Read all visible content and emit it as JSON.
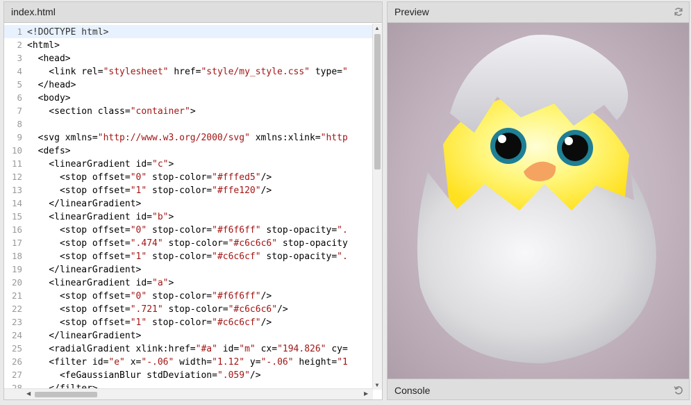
{
  "editor": {
    "filename": "index.html",
    "lines": [
      {
        "n": "1",
        "parts": [
          [
            "doc",
            "<!DOCTYPE html>"
          ]
        ]
      },
      {
        "n": "2",
        "parts": [
          [
            "tag",
            "<html>"
          ]
        ]
      },
      {
        "n": "3",
        "parts": [
          [
            "tag",
            "  <head>"
          ]
        ]
      },
      {
        "n": "4",
        "parts": [
          [
            "tag",
            "    <link rel="
          ],
          [
            "str",
            "\"stylesheet\""
          ],
          [
            "tag",
            " href="
          ],
          [
            "str",
            "\"style/my_style.css\""
          ],
          [
            "tag",
            " type="
          ],
          [
            "str",
            "\""
          ]
        ]
      },
      {
        "n": "5",
        "parts": [
          [
            "tag",
            "  </head>"
          ]
        ]
      },
      {
        "n": "6",
        "parts": [
          [
            "tag",
            "  <body>"
          ]
        ]
      },
      {
        "n": "7",
        "parts": [
          [
            "tag",
            "    <section class="
          ],
          [
            "str",
            "\"container\""
          ],
          [
            "tag",
            ">"
          ]
        ]
      },
      {
        "n": "8",
        "parts": []
      },
      {
        "n": "9",
        "parts": [
          [
            "tag",
            "  <svg xmlns="
          ],
          [
            "str",
            "\"http://www.w3.org/2000/svg\""
          ],
          [
            "tag",
            " xmlns:xlink="
          ],
          [
            "str",
            "\"http"
          ]
        ]
      },
      {
        "n": "10",
        "parts": [
          [
            "tag",
            "  <defs>"
          ]
        ]
      },
      {
        "n": "11",
        "parts": [
          [
            "tag",
            "    <linearGradient id="
          ],
          [
            "str",
            "\"c\""
          ],
          [
            "tag",
            ">"
          ]
        ]
      },
      {
        "n": "12",
        "parts": [
          [
            "tag",
            "      <stop offset="
          ],
          [
            "str",
            "\"0\""
          ],
          [
            "tag",
            " stop-color="
          ],
          [
            "str",
            "\"#fffed5\""
          ],
          [
            "tag",
            "/>"
          ]
        ]
      },
      {
        "n": "13",
        "parts": [
          [
            "tag",
            "      <stop offset="
          ],
          [
            "str",
            "\"1\""
          ],
          [
            "tag",
            " stop-color="
          ],
          [
            "str",
            "\"#ffe120\""
          ],
          [
            "tag",
            "/>"
          ]
        ]
      },
      {
        "n": "14",
        "parts": [
          [
            "tag",
            "    </linearGradient>"
          ]
        ]
      },
      {
        "n": "15",
        "parts": [
          [
            "tag",
            "    <linearGradient id="
          ],
          [
            "str",
            "\"b\""
          ],
          [
            "tag",
            ">"
          ]
        ]
      },
      {
        "n": "16",
        "parts": [
          [
            "tag",
            "      <stop offset="
          ],
          [
            "str",
            "\"0\""
          ],
          [
            "tag",
            " stop-color="
          ],
          [
            "str",
            "\"#f6f6ff\""
          ],
          [
            "tag",
            " stop-opacity="
          ],
          [
            "str",
            "\"."
          ]
        ]
      },
      {
        "n": "17",
        "parts": [
          [
            "tag",
            "      <stop offset="
          ],
          [
            "str",
            "\".474\""
          ],
          [
            "tag",
            " stop-color="
          ],
          [
            "str",
            "\"#c6c6c6\""
          ],
          [
            "tag",
            " stop-opacity"
          ]
        ]
      },
      {
        "n": "18",
        "parts": [
          [
            "tag",
            "      <stop offset="
          ],
          [
            "str",
            "\"1\""
          ],
          [
            "tag",
            " stop-color="
          ],
          [
            "str",
            "\"#c6c6cf\""
          ],
          [
            "tag",
            " stop-opacity="
          ],
          [
            "str",
            "\"."
          ]
        ]
      },
      {
        "n": "19",
        "parts": [
          [
            "tag",
            "    </linearGradient>"
          ]
        ]
      },
      {
        "n": "20",
        "parts": [
          [
            "tag",
            "    <linearGradient id="
          ],
          [
            "str",
            "\"a\""
          ],
          [
            "tag",
            ">"
          ]
        ]
      },
      {
        "n": "21",
        "parts": [
          [
            "tag",
            "      <stop offset="
          ],
          [
            "str",
            "\"0\""
          ],
          [
            "tag",
            " stop-color="
          ],
          [
            "str",
            "\"#f6f6ff\""
          ],
          [
            "tag",
            "/>"
          ]
        ]
      },
      {
        "n": "22",
        "parts": [
          [
            "tag",
            "      <stop offset="
          ],
          [
            "str",
            "\".721\""
          ],
          [
            "tag",
            " stop-color="
          ],
          [
            "str",
            "\"#c6c6c6\""
          ],
          [
            "tag",
            "/>"
          ]
        ]
      },
      {
        "n": "23",
        "parts": [
          [
            "tag",
            "      <stop offset="
          ],
          [
            "str",
            "\"1\""
          ],
          [
            "tag",
            " stop-color="
          ],
          [
            "str",
            "\"#c6c6cf\""
          ],
          [
            "tag",
            "/>"
          ]
        ]
      },
      {
        "n": "24",
        "parts": [
          [
            "tag",
            "    </linearGradient>"
          ]
        ]
      },
      {
        "n": "25",
        "parts": [
          [
            "tag",
            "    <radialGradient xlink:href="
          ],
          [
            "str",
            "\"#a\""
          ],
          [
            "tag",
            " id="
          ],
          [
            "str",
            "\"m\""
          ],
          [
            "tag",
            " cx="
          ],
          [
            "str",
            "\"194.826\""
          ],
          [
            "tag",
            " cy="
          ]
        ]
      },
      {
        "n": "26",
        "parts": [
          [
            "tag",
            "    <filter id="
          ],
          [
            "str",
            "\"e\""
          ],
          [
            "tag",
            " x="
          ],
          [
            "str",
            "\"-.06\""
          ],
          [
            "tag",
            " width="
          ],
          [
            "str",
            "\"1.12\""
          ],
          [
            "tag",
            " y="
          ],
          [
            "str",
            "\"-.06\""
          ],
          [
            "tag",
            " height="
          ],
          [
            "str",
            "\"1"
          ]
        ]
      },
      {
        "n": "27",
        "parts": [
          [
            "tag",
            "      <feGaussianBlur stdDeviation="
          ],
          [
            "str",
            "\".059\""
          ],
          [
            "tag",
            "/>"
          ]
        ]
      },
      {
        "n": "28",
        "parts": [
          [
            "tag",
            "    </filter>"
          ]
        ]
      }
    ]
  },
  "preview": {
    "title": "Preview",
    "refresh_icon": "refresh-icon"
  },
  "console": {
    "title": "Console",
    "reset_icon": "undo-icon"
  },
  "colors": {
    "chick_light": "#fffed5",
    "chick_dark": "#ffe120",
    "egg_light": "#f6f6ff",
    "egg_mid": "#c6c6c6",
    "eye_iris": "#1f7f94",
    "beak": "#f4a460"
  }
}
